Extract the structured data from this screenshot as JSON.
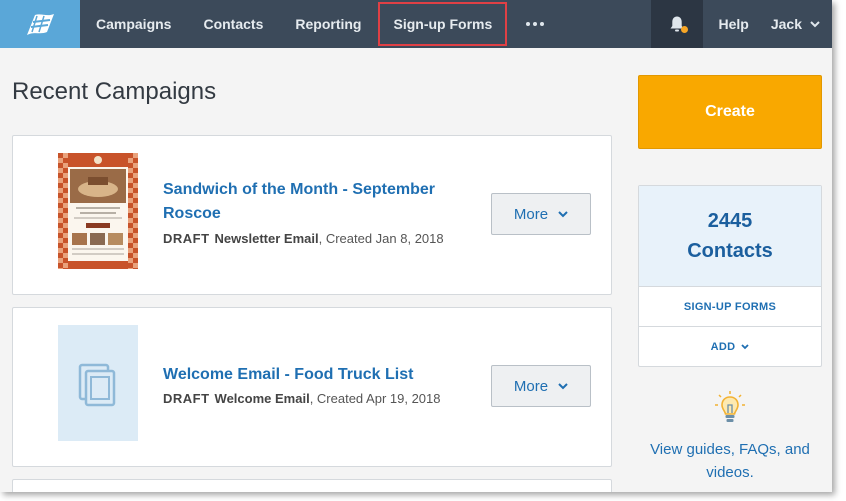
{
  "nav": {
    "items": [
      {
        "label": "Campaigns"
      },
      {
        "label": "Contacts"
      },
      {
        "label": "Reporting"
      },
      {
        "label": "Sign-up Forms"
      }
    ],
    "help_label": "Help",
    "user_label": "Jack"
  },
  "main": {
    "title": "Recent Campaigns",
    "campaigns": [
      {
        "title": "Sandwich of the Month - September Roscoe",
        "status": "DRAFT",
        "type": "Newsletter Email",
        "created": ", Created Jan 8, 2018",
        "more_label": "More"
      },
      {
        "title": "Welcome Email - Food Truck List",
        "status": "DRAFT",
        "type": "Welcome Email",
        "created": ", Created Apr 19, 2018",
        "more_label": "More"
      }
    ]
  },
  "sidebar": {
    "create_label": "Create",
    "contacts_count": "2445",
    "contacts_label": "Contacts",
    "signup_forms_label": "SIGN-UP FORMS",
    "add_label": "ADD",
    "guide_text": "View guides, FAQs, and videos."
  },
  "colors": {
    "nav_bg": "#3c4a5a",
    "logo_bg": "#5aa7d8",
    "accent_orange": "#f9a800",
    "link_blue": "#1f6fb2",
    "highlight_red": "#e04045"
  }
}
